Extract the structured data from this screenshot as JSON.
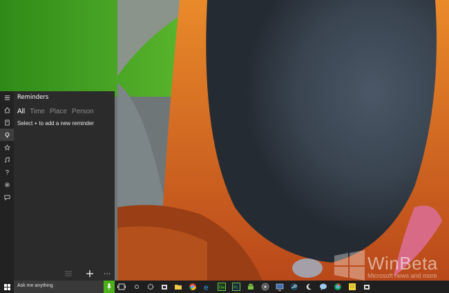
{
  "panel": {
    "title": "Reminders",
    "tabs": [
      "All",
      "Time",
      "Place",
      "Person"
    ],
    "selected_tab": "All",
    "hint": "Select + to add a new reminder",
    "rail_icons": [
      "home-icon",
      "notebook-icon",
      "reminders-icon",
      "star-icon",
      "music-icon",
      "help-icon",
      "settings-icon",
      "feedback-icon"
    ]
  },
  "taskbar": {
    "search_placeholder": "Ask me anything",
    "icons": [
      "task-view-icon",
      "cortana-circle-icon",
      "settings-icon",
      "store-icon",
      "file-explorer-icon",
      "chrome-icon",
      "edge-icon",
      "dreamweaver-icon",
      "photoshop-icon",
      "android-icon",
      "obs-icon",
      "monitor-icon",
      "steam-icon",
      "moon-icon",
      "chat-icon",
      "chrome-alt-icon",
      "sticky-notes-icon",
      "store-alt-icon"
    ]
  },
  "watermark": {
    "text": "WinBeta",
    "subtext": "Microsoft news and more"
  },
  "colors": {
    "panel_bg": "#2b2b2b",
    "accent_green": "#4caf1a",
    "taskbar_bg": "#1f1f1f"
  }
}
